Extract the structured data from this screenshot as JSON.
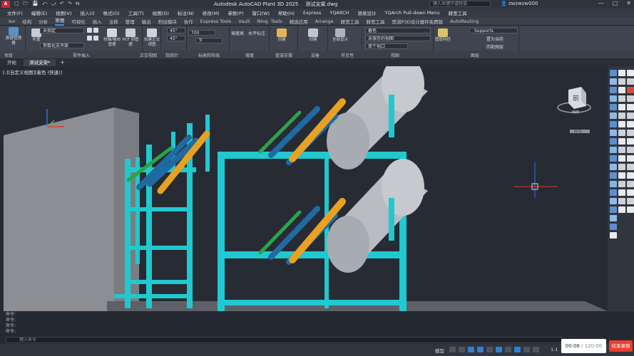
{
  "app": {
    "logo": "A",
    "title": "Autodesk AutoCAD Plant 3D 2025",
    "filename": "测试支架.dwg",
    "search_placeholder": "键入关键字或短语",
    "user": "zwzwzw000",
    "quick_access": [
      "▢",
      "🗁",
      "💾",
      "⤺",
      "⤻",
      "↶",
      "↷",
      "⇆"
    ],
    "window_buttons": [
      "—",
      "▢",
      "✕"
    ]
  },
  "menubar": [
    "文件(F)",
    "编辑(E)",
    "视图(V)",
    "插入(I)",
    "格式(O)",
    "工具(T)",
    "绘图(D)",
    "标注(N)",
    "修改(M)",
    "参数(P)",
    "窗口(W)",
    "帮助(H)",
    "Express",
    "YQARCH",
    "源泉设计",
    "YQArch Pull-down Menu",
    "赫思工具"
  ],
  "ribbon_tabs": [
    {
      "label": "Iso",
      "active": false
    },
    {
      "label": "结构",
      "active": false
    },
    {
      "label": "分析",
      "active": false
    },
    {
      "label": "常用",
      "active": true
    },
    {
      "label": "可视化",
      "active": false
    },
    {
      "label": "插入",
      "active": false
    },
    {
      "label": "注释",
      "active": false
    },
    {
      "label": "管理",
      "active": false
    },
    {
      "label": "输出",
      "active": false
    },
    {
      "label": "附加模块",
      "active": false
    },
    {
      "label": "协作",
      "active": false
    },
    {
      "label": "Express Tools",
      "active": false
    },
    {
      "label": "Vault",
      "active": false
    },
    {
      "label": "Ning. Tools",
      "active": false
    },
    {
      "label": "精选应用",
      "active": false
    },
    {
      "label": "Arrange",
      "active": false
    },
    {
      "label": "赫思工具",
      "active": false
    },
    {
      "label": "赫思工具",
      "active": false
    },
    {
      "label": "思润P3D设计器件免费版",
      "active": false
    },
    {
      "label": "AutoRouting",
      "active": false
    }
  ],
  "ribbon": {
    "project_btn": "数据管理器",
    "layout_btn": "布置",
    "combo_unspecified": "未指定",
    "combo_param": "参数化支吊架",
    "route_btn": "线轴/轴向管理",
    "pcf_btn": "PCF 到管理",
    "ortho_btn": "创建正交视图",
    "angle1": "45°",
    "angle2": "45°",
    "length": "700",
    "slope_label": "坡度高",
    "slope_value": "水平标注",
    "dir_value": "下",
    "create_btn": "创建",
    "all_btn": "全部显示",
    "visual_style": "着色",
    "view_state": "未保存的视图",
    "viewport": "单个视口",
    "layer_name": "_Supports",
    "layer_props": "图层特性",
    "match_layer": "置为当前",
    "layer_match": "匹配图层"
  },
  "group_labels": [
    {
      "label": "项目"
    },
    {
      "label": "零件插入"
    },
    {
      "label": "正交视图"
    },
    {
      "label": "指南针"
    },
    {
      "label": "标高和布线"
    },
    {
      "label": "坡度"
    },
    {
      "label": "管道支撑"
    },
    {
      "label": "设备"
    },
    {
      "label": "可见性"
    },
    {
      "label": "视图"
    },
    {
      "label": "图层"
    }
  ],
  "file_tabs": [
    {
      "label": "开始",
      "active": false
    },
    {
      "label": "测试支架*",
      "active": true
    },
    {
      "label": "+",
      "active": false
    }
  ],
  "viewport": {
    "label": "[-][自定义视图][着色 (快速)]",
    "viewcube_label": "前",
    "viewcube_sub": "西南",
    "wcs": "WCS"
  },
  "command": {
    "history": [
      "命令:",
      "命令:",
      "命令:",
      "命令:"
    ],
    "placeholder": "键入命令"
  },
  "status": {
    "model": "模型",
    "scale": "1:1",
    "player_time": "00:06",
    "player_total": "/ 120:00",
    "end_button": "结束录制"
  },
  "colors": {
    "steel": "#1fc9cf",
    "pipe_gray": "#b9bcc2",
    "pipe_orange": "#e8a122",
    "pipe_blue": "#1f6aa0",
    "pipe_green": "#2aa44b",
    "box": "#8f9095",
    "accent": "#2f8fe4"
  }
}
